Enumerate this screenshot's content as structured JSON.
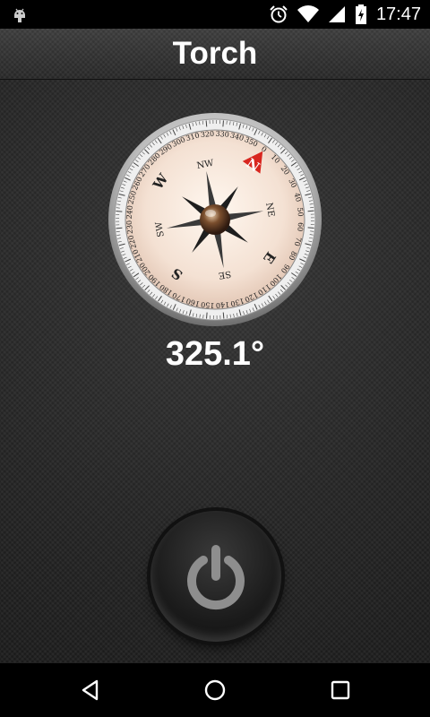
{
  "status_bar": {
    "time": "17:47",
    "icons": [
      "android-debug-icon",
      "alarm-icon",
      "wifi-icon",
      "cell-signal-icon",
      "battery-charging-icon"
    ]
  },
  "header": {
    "title": "Torch"
  },
  "compass": {
    "heading_display": "325.1°",
    "cardinal_labels": [
      "N",
      "NE",
      "E",
      "SE",
      "S",
      "SW",
      "W",
      "NW"
    ],
    "degree_labels": [
      "0",
      "10",
      "20",
      "30",
      "40",
      "50",
      "60",
      "70",
      "80",
      "90",
      "100",
      "110",
      "120",
      "130",
      "140",
      "150",
      "160",
      "170",
      "180",
      "190",
      "200",
      "210",
      "220",
      "230",
      "240",
      "250",
      "260",
      "270",
      "280",
      "290",
      "300",
      "310",
      "320",
      "330",
      "340",
      "350"
    ],
    "colors": {
      "north_marker": "#d8261f",
      "face": "#f7eadf",
      "needle": "#3b2a20"
    }
  },
  "power_button": {
    "icon": "power-icon",
    "state": "off"
  },
  "nav_bar": {
    "buttons": [
      "back-icon",
      "home-icon",
      "recents-icon"
    ]
  }
}
